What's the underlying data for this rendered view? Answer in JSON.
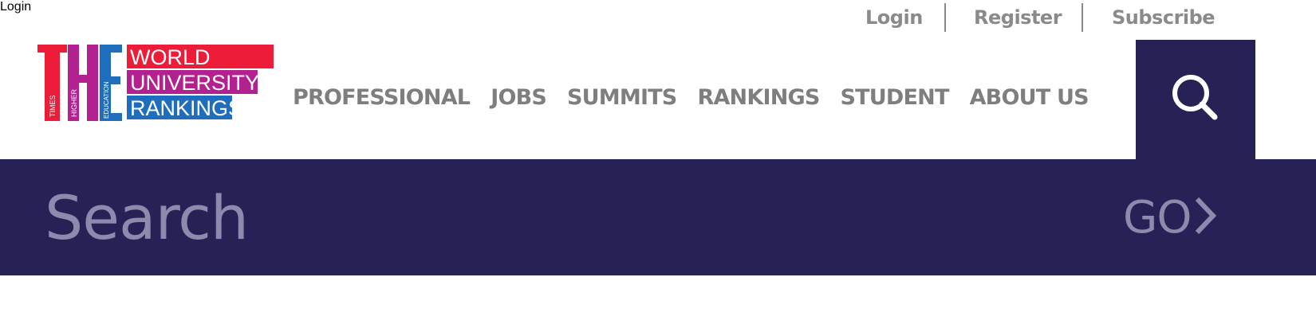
{
  "utility_links": {
    "login": "Login",
    "register": "Register",
    "subscribe": "Subscribe"
  },
  "logo": {
    "letters": [
      "T",
      "H",
      "E"
    ],
    "vertical_words": [
      "TIMES",
      "HIGHER",
      "EDUCATION"
    ],
    "banner_lines": [
      "WORLD",
      "UNIVERSITY",
      "RANKINGS"
    ],
    "colors": {
      "red": "#ed1c39",
      "magenta": "#b3208f",
      "blue": "#1f6dbd"
    }
  },
  "nav": {
    "items": [
      "PROFESSIONAL",
      "JOBS",
      "SUMMITS",
      "RANKINGS",
      "STUDENT",
      "ABOUT US"
    ]
  },
  "search": {
    "placeholder": "Search",
    "go_label": "GO",
    "toggle_icon": "search-icon",
    "go_icon": "chevron-right-icon"
  },
  "colors": {
    "navy": "#262256",
    "nav_text": "#7e7e7e",
    "search_text": "#8d8aae"
  }
}
